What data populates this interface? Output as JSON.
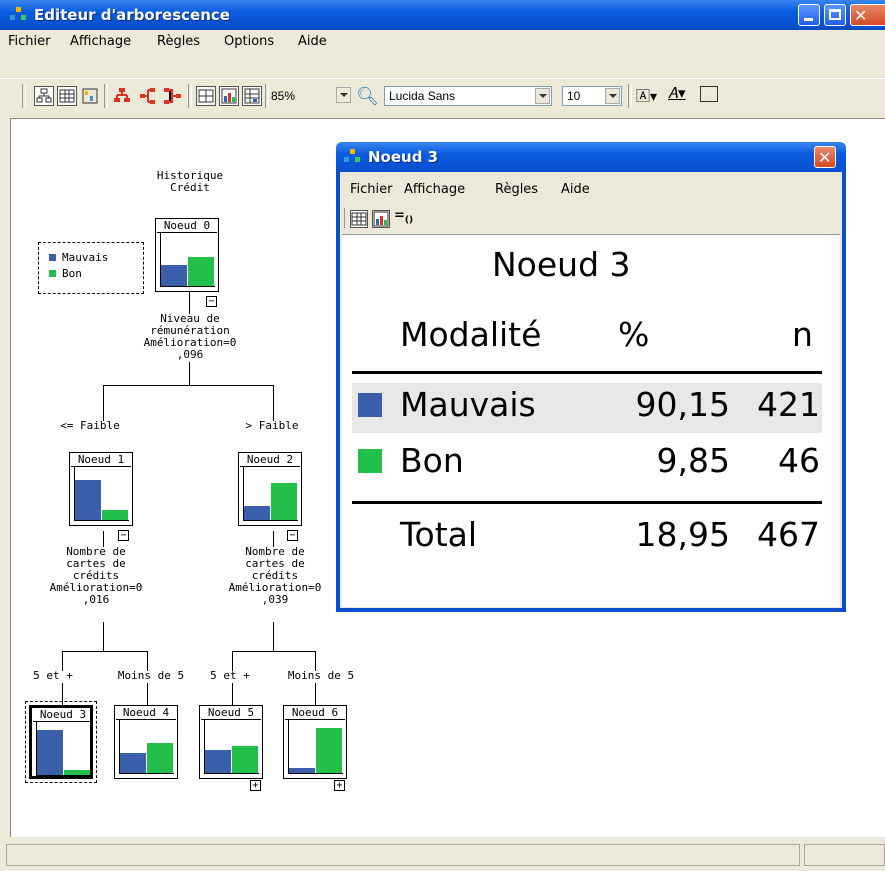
{
  "window": {
    "title": "Editeur d'arborescence"
  },
  "menu": {
    "items": [
      "Fichier",
      "Affichage",
      "Règles",
      "Options",
      "Aide"
    ]
  },
  "toolbar": {
    "zoom": "85%",
    "font": "Lucida Sans",
    "font_size": "10"
  },
  "legend": {
    "items": [
      {
        "label": "Mauvais",
        "color": "#3a5fab"
      },
      {
        "label": "Bon",
        "color": "#22c04a"
      }
    ]
  },
  "tree": {
    "root_label": "Historique\nCrédit",
    "split0_label": "Niveau de\nrémunération\nAmélioration=0\n,096",
    "branch_left": "<= Faible",
    "branch_right": "> Faible",
    "split1_label": "Nombre de\ncartes de\ncrédits\nAmélioration=0\n,016",
    "split2_label": "Nombre de\ncartes de\ncrédits\nAmélioration=0\n,039",
    "branch_5plus_a": "5 et +",
    "branch_lt5_a": "Moins de 5",
    "branch_5plus_b": "5 et +",
    "branch_lt5_b": "Moins de 5",
    "nodes": [
      {
        "title": "Noeud 0",
        "mauvais": 0.42,
        "bon": 0.58,
        "expander": "−"
      },
      {
        "title": "Noeud 1",
        "mauvais": 0.8,
        "bon": 0.2,
        "expander": "−"
      },
      {
        "title": "Noeud 2",
        "mauvais": 0.27,
        "bon": 0.73,
        "expander": "−"
      },
      {
        "title": "Noeud 3",
        "mauvais": 0.9015,
        "bon": 0.0985
      },
      {
        "title": "Noeud 4",
        "mauvais": 0.4,
        "bon": 0.6
      },
      {
        "title": "Noeud 5",
        "mauvais": 0.46,
        "bon": 0.54,
        "expander": "+"
      },
      {
        "title": "Noeud 6",
        "mauvais": 0.1,
        "bon": 0.9,
        "expander": "+"
      }
    ]
  },
  "node_window": {
    "title": "Noeud 3",
    "menu": [
      "Fichier",
      "Affichage",
      "Règles",
      "Aide"
    ],
    "heading": "Noeud 3",
    "columns": [
      "Modalité",
      "%",
      "n"
    ],
    "rows": [
      {
        "label": "Mauvais",
        "pct": "90,15",
        "n": "421",
        "color": "#3a5fab"
      },
      {
        "label": "Bon",
        "pct": "9,85",
        "n": "46",
        "color": "#22c04a"
      }
    ],
    "total": {
      "label": "Total",
      "pct": "18,95",
      "n": "467"
    }
  }
}
